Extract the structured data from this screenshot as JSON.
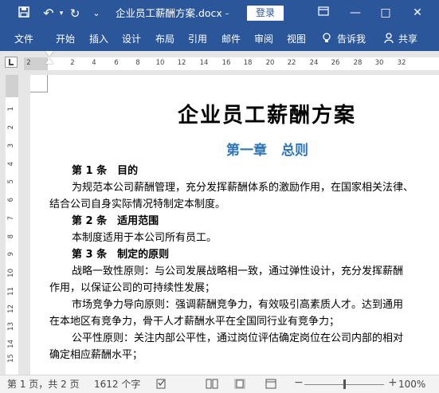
{
  "titlebar": {
    "title": "企业员工薪酬方案.docx  -",
    "login_label": "登录",
    "save_icon": "💾",
    "undo_icon": "↶",
    "redo_icon": "↻",
    "customize_icon": "⌄",
    "restore_icon": "▭",
    "minimize_icon": "—",
    "maximize_icon": "□",
    "close_icon": "✕"
  },
  "ribbon": {
    "tabs": [
      "文件",
      "开始",
      "插入",
      "设计",
      "布局",
      "引用",
      "邮件",
      "审阅",
      "视图"
    ],
    "tell_me_label": "告诉我",
    "tell_me_icon": "💡",
    "share_label": "共享",
    "share_icon": "👤"
  },
  "ruler": {
    "horizontal_ticks": [
      "2",
      "2",
      "4",
      "6",
      "8",
      "10",
      "12",
      "14",
      "16",
      "18",
      "20",
      "22",
      "24",
      "26",
      "28",
      "30",
      "32"
    ],
    "vertical_ticks": [
      "1",
      "2",
      "3",
      "4",
      "5",
      "6",
      "7",
      "8",
      "9",
      "10",
      "11",
      "12",
      "13",
      "14",
      "15",
      "16"
    ]
  },
  "document": {
    "title": "企业员工薪酬方案",
    "chapter_num": "第一章",
    "chapter_name": "总则",
    "lines": [
      {
        "text": "第 1 条　目的",
        "bold": true
      },
      {
        "text": "为规范本公司薪酬管理，充分发挥薪酬体系的激励作用，在国家相关法律、",
        "bold": false
      },
      {
        "text": "结合公司自身实际情况特制定本制度。",
        "bold": false
      },
      {
        "text": "第 2 条　适用范围",
        "bold": true
      },
      {
        "text": "本制度适用于本公司所有员工。",
        "bold": false
      },
      {
        "text": "第 3 条　制定的原则",
        "bold": true
      },
      {
        "text": "战略一致性原则：与公司发展战略相一致，通过弹性设计，充分发挥薪酬",
        "bold": false
      },
      {
        "text": "作用，以保证公司的可持续性发展；",
        "bold": false
      },
      {
        "text": "市场竞争力导向原则：强调薪酬竞争力，有效吸引高素质人才。达到通用",
        "bold": false
      },
      {
        "text": "在本地区有竞争力，骨干人才薪酬水平在全国同行业有竞争力；",
        "bold": false
      },
      {
        "text": "公平性原则：关注内部公平性，通过岗位评估确定岗位在公司内部的相对",
        "bold": false
      },
      {
        "text": "确定相应薪酬水平；",
        "bold": false
      }
    ]
  },
  "statusbar": {
    "page_info": "第 1 页，共 2 页",
    "word_count": "1612 个字",
    "zoom_out": "−",
    "zoom_in": "+",
    "zoom_level": "100%",
    "zoom_fraction": 0.5
  }
}
